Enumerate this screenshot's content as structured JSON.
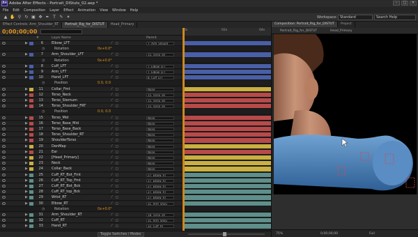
{
  "titlebar": {
    "logo": "Ae",
    "title": "Adobe After Effects - Portrait_DIStuts_02.aep *"
  },
  "menu": [
    "File",
    "Edit",
    "Composition",
    "Layer",
    "Effect",
    "Animation",
    "View",
    "Window",
    "Help"
  ],
  "toolbar": {
    "workspace_label": "Workspace:",
    "workspace_value": "Standard",
    "search_help": "Search Help"
  },
  "timeline": {
    "tabs": [
      "Effect Controls: Arm_Shoulder_RT",
      "Portrait_Rig_for_DISTUT",
      "Head_Primary"
    ],
    "active_tab": 1,
    "timecode": "0;00;00;00",
    "search_placeholder": "",
    "col_headers": {
      "num": "#",
      "name": "Layer Name",
      "parent": "Parent"
    },
    "ruler_marks": [
      "0s",
      "02s",
      "04s"
    ],
    "toggle_label": "Toggle Switches / Modes",
    "layers": [
      {
        "type": "layer",
        "num": "6",
        "name": "Elbow_LFT",
        "parent": "7. Arm_Should",
        "color": "#4a5fa8",
        "value": ""
      },
      {
        "type": "prop",
        "name": "Rotation",
        "value": "0x+0.0°"
      },
      {
        "type": "layer",
        "num": "7",
        "name": "Arm_Shoulder_LFT",
        "parent": "15. Torso_Sh",
        "color": "#4a5fa8",
        "value": ""
      },
      {
        "type": "prop",
        "name": "Rotation",
        "value": "0x+0.0°"
      },
      {
        "type": "layer",
        "num": "8",
        "name": "Cuff_LFT",
        "parent": "7. Elbow_LFT",
        "color": "#4a5fa8",
        "value": ""
      },
      {
        "type": "layer",
        "num": "9",
        "name": "Arm_LFT",
        "parent": "7. Elbow_LFT",
        "color": "#4a5fa8",
        "value": ""
      },
      {
        "type": "layer",
        "num": "10",
        "name": "Hand_LFT",
        "parent": "8. Cuff_LFT",
        "color": "#4a5fa8",
        "value": ""
      },
      {
        "type": "prop",
        "name": "Position",
        "value": "0.0, 0.0"
      },
      {
        "type": "layer",
        "num": "11",
        "name": "Collar_Frnt",
        "parent": "None",
        "color": "#c9b040",
        "value": ""
      },
      {
        "type": "layer",
        "num": "12",
        "name": "Torso_Neck",
        "parent": "15. Torso_Sh",
        "color": "#b84a4a",
        "value": ""
      },
      {
        "type": "layer",
        "num": "13",
        "name": "Torso_Sternum",
        "parent": "15. Torso_Sh",
        "color": "#b84a4a",
        "value": ""
      },
      {
        "type": "layer",
        "num": "14",
        "name": "Torso_Shoulder_FRT",
        "parent": "15. Torso_Sh",
        "color": "#b84a4a",
        "value": ""
      },
      {
        "type": "prop",
        "name": "Position",
        "value": "0.0, 0.0"
      },
      {
        "type": "layer",
        "num": "15",
        "name": "Torso_Mid",
        "parent": "None",
        "color": "#b84a4a",
        "value": ""
      },
      {
        "type": "layer",
        "num": "16",
        "name": "Torso_Base_Mid",
        "parent": "None",
        "color": "#b84a4a",
        "value": ""
      },
      {
        "type": "layer",
        "num": "17",
        "name": "Torso_Base_Back",
        "parent": "None",
        "color": "#b84a4a",
        "value": ""
      },
      {
        "type": "layer",
        "num": "18",
        "name": "Torso_Shoulder_RT",
        "parent": "None",
        "color": "#b84a4a",
        "value": ""
      },
      {
        "type": "layer",
        "num": "19",
        "name": "ShoulderTorso",
        "parent": "None",
        "color": "#b84a4a",
        "value": ""
      },
      {
        "type": "layer",
        "num": "20",
        "name": "DenMap",
        "parent": "None",
        "color": "#c9b040",
        "value": ""
      },
      {
        "type": "layer",
        "num": "21",
        "name": "Ear",
        "parent": "None",
        "color": "#b84a4a",
        "value": ""
      },
      {
        "type": "layer",
        "num": "22",
        "name": "[Head_Primary]",
        "parent": "None",
        "color": "#c9b040",
        "value": ""
      },
      {
        "type": "layer",
        "num": "23",
        "name": "Neck",
        "parent": "None",
        "color": "#c9b040",
        "value": ""
      },
      {
        "type": "layer",
        "num": "24",
        "name": "Collar_Back",
        "parent": "None",
        "color": "#c9b040",
        "value": ""
      },
      {
        "type": "layer",
        "num": "25",
        "name": "Cuff_RT_Bot_Frnt",
        "parent": "27. Elbow_RT",
        "color": "#5f8f8a",
        "value": ""
      },
      {
        "type": "layer",
        "num": "26",
        "name": "Cuff_RT_Top_Frnt",
        "parent": "27. Elbow_RT",
        "color": "#5f8f8a",
        "value": ""
      },
      {
        "type": "layer",
        "num": "27",
        "name": "Cuff_RT_Bot_Bck",
        "parent": "27. Elbow_RT",
        "color": "#5f8f8a",
        "value": ""
      },
      {
        "type": "layer",
        "num": "28",
        "name": "Cuff_RT_top_Bck",
        "parent": "27. Elbow_RT",
        "color": "#5f8f8a",
        "value": ""
      },
      {
        "type": "layer",
        "num": "29",
        "name": "Wrist_RT",
        "parent": "27. Elbow_RT",
        "color": "#5f8f8a",
        "value": ""
      },
      {
        "type": "layer",
        "num": "30",
        "name": "Elbow_RT",
        "parent": "31. Arm_Shou",
        "color": "#5f8f8a",
        "value": ""
      },
      {
        "type": "prop",
        "name": "Rotation",
        "value": "0x+0.0°"
      },
      {
        "type": "layer",
        "num": "31",
        "name": "Arm_Shoulder_RT",
        "parent": "18. Torso_Sh",
        "color": "#5f8f8a",
        "value": ""
      },
      {
        "type": "layer",
        "num": "32",
        "name": "Cuff_RT",
        "parent": "31. Arm_Shou",
        "color": "#5f8f8a",
        "value": ""
      },
      {
        "type": "layer",
        "num": "33",
        "name": "Hand_RT",
        "parent": "32. Cuff_RT",
        "color": "#5f8f8a",
        "value": ""
      }
    ]
  },
  "composition": {
    "tabs": [
      "Composition: Portrait_Rig_for_DISTUT",
      "Project"
    ],
    "sub_labels": [
      "Portrait_Rig_for_DISTUT",
      "Head_Primary"
    ],
    "footer": {
      "zoom": "75%",
      "timecode": "0;00;00;00",
      "resolution": "Full"
    }
  }
}
